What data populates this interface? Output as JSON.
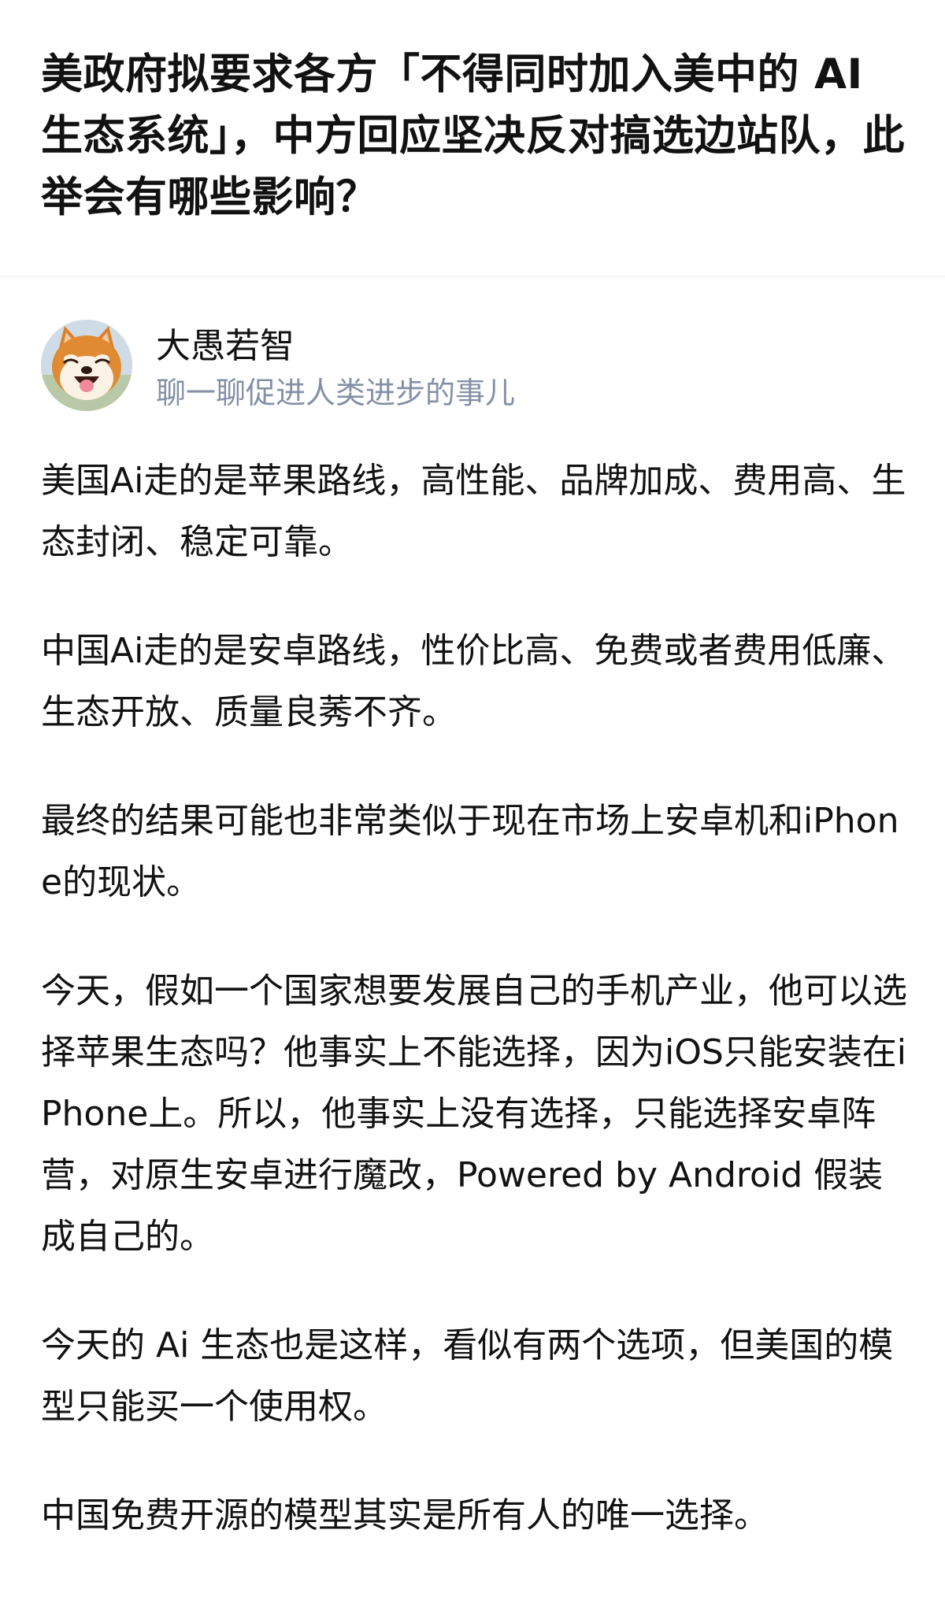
{
  "question": {
    "title": "美政府拟要求各方「不得同时加入美中的 AI 生态系统」，中方回应坚决反对搞选边站队，此举会有哪些影响？"
  },
  "author": {
    "name": "大愚若智",
    "bio": "聊一聊促进人类进步的事儿",
    "avatar_icon": "shiba-inu-avatar"
  },
  "answer": {
    "paragraphs": [
      "美国Ai走的是苹果路线，高性能、品牌加成、费用高、生态封闭、稳定可靠。",
      "中国Ai走的是安卓路线，性价比高、免费或者费用低廉、生态开放、质量良莠不齐。",
      "最终的结果可能也非常类似于现在市场上安卓机和iPhone的现状。",
      "今天，假如一个国家想要发展自己的手机产业，他可以选择苹果生态吗？他事实上不能选择，因为iOS只能安装在iPhone上。所以，他事实上没有选择，只能选择安卓阵营，对原生安卓进行魔改，Powered by Android 假装成自己的。",
      "今天的 Ai 生态也是这样，看似有两个选项，但美国的模型只能买一个使用权。",
      "中国免费开源的模型其实是所有人的唯一选择。"
    ]
  },
  "colors": {
    "text": "#121212",
    "secondary": "#8590a6",
    "divider": "#f2f2f2"
  }
}
